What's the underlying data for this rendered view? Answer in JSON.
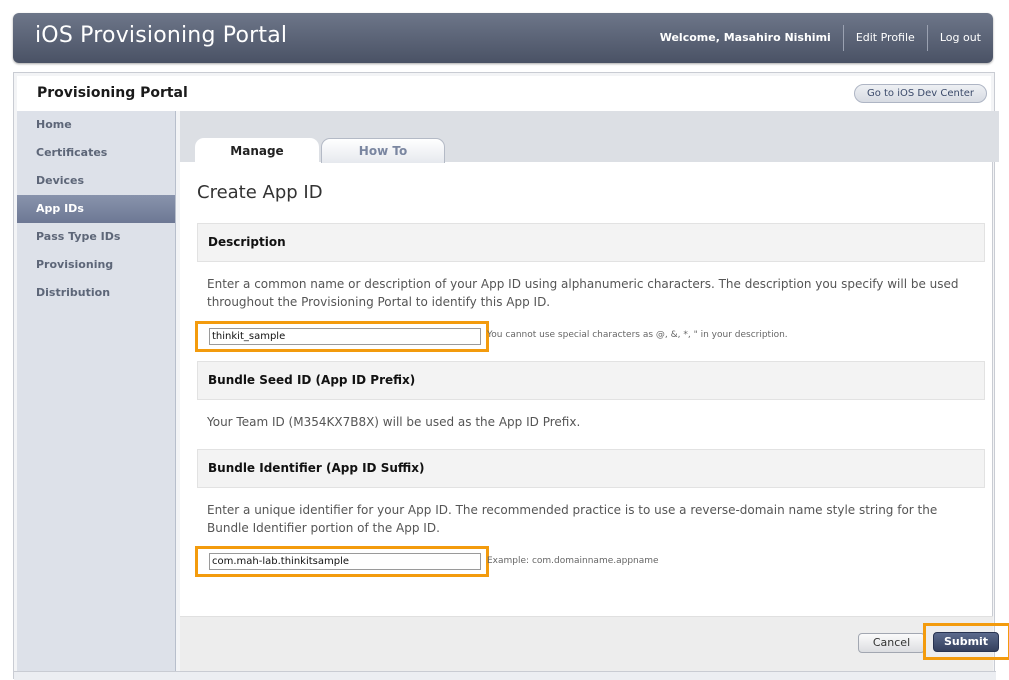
{
  "banner": {
    "title": "iOS Provisioning Portal",
    "welcome": "Welcome, Masahiro Nishimi",
    "edit_profile": "Edit Profile",
    "log_out": "Log out"
  },
  "portal": {
    "title": "Provisioning Portal",
    "dev_center_button": "Go to iOS Dev Center"
  },
  "sidebar": {
    "items": [
      {
        "label": "Home"
      },
      {
        "label": "Certificates"
      },
      {
        "label": "Devices"
      },
      {
        "label": "App IDs",
        "active": true
      },
      {
        "label": "Pass Type IDs"
      },
      {
        "label": "Provisioning"
      },
      {
        "label": "Distribution"
      }
    ]
  },
  "tabs": [
    {
      "label": "Manage",
      "active": true
    },
    {
      "label": "How To"
    }
  ],
  "form": {
    "title": "Create App ID",
    "description": {
      "heading": "Description",
      "text": "Enter a common name or description of your App ID using alphanumeric characters. The description you specify will be used throughout the Provisioning Portal to identify this App ID.",
      "value": "thinkit_sample",
      "note": "You cannot use special characters as @, &, *, \" in your description."
    },
    "seed": {
      "heading": "Bundle Seed ID (App ID Prefix)",
      "text": "Your Team ID (M354KX7B8X) will be used as the App ID Prefix."
    },
    "bundle": {
      "heading": "Bundle Identifier (App ID Suffix)",
      "text": "Enter a unique identifier for your App ID. The recommended practice is to use a reverse-domain name style string for the Bundle Identifier portion of the App ID.",
      "value": "com.mah-lab.thinkitsample",
      "note": "Example: com.domainname.appname"
    },
    "cancel_label": "Cancel",
    "submit_label": "Submit"
  },
  "colors": {
    "highlight": "#f39b0d",
    "banner": "#5a6276",
    "sidebar_active": "#7480a0"
  }
}
